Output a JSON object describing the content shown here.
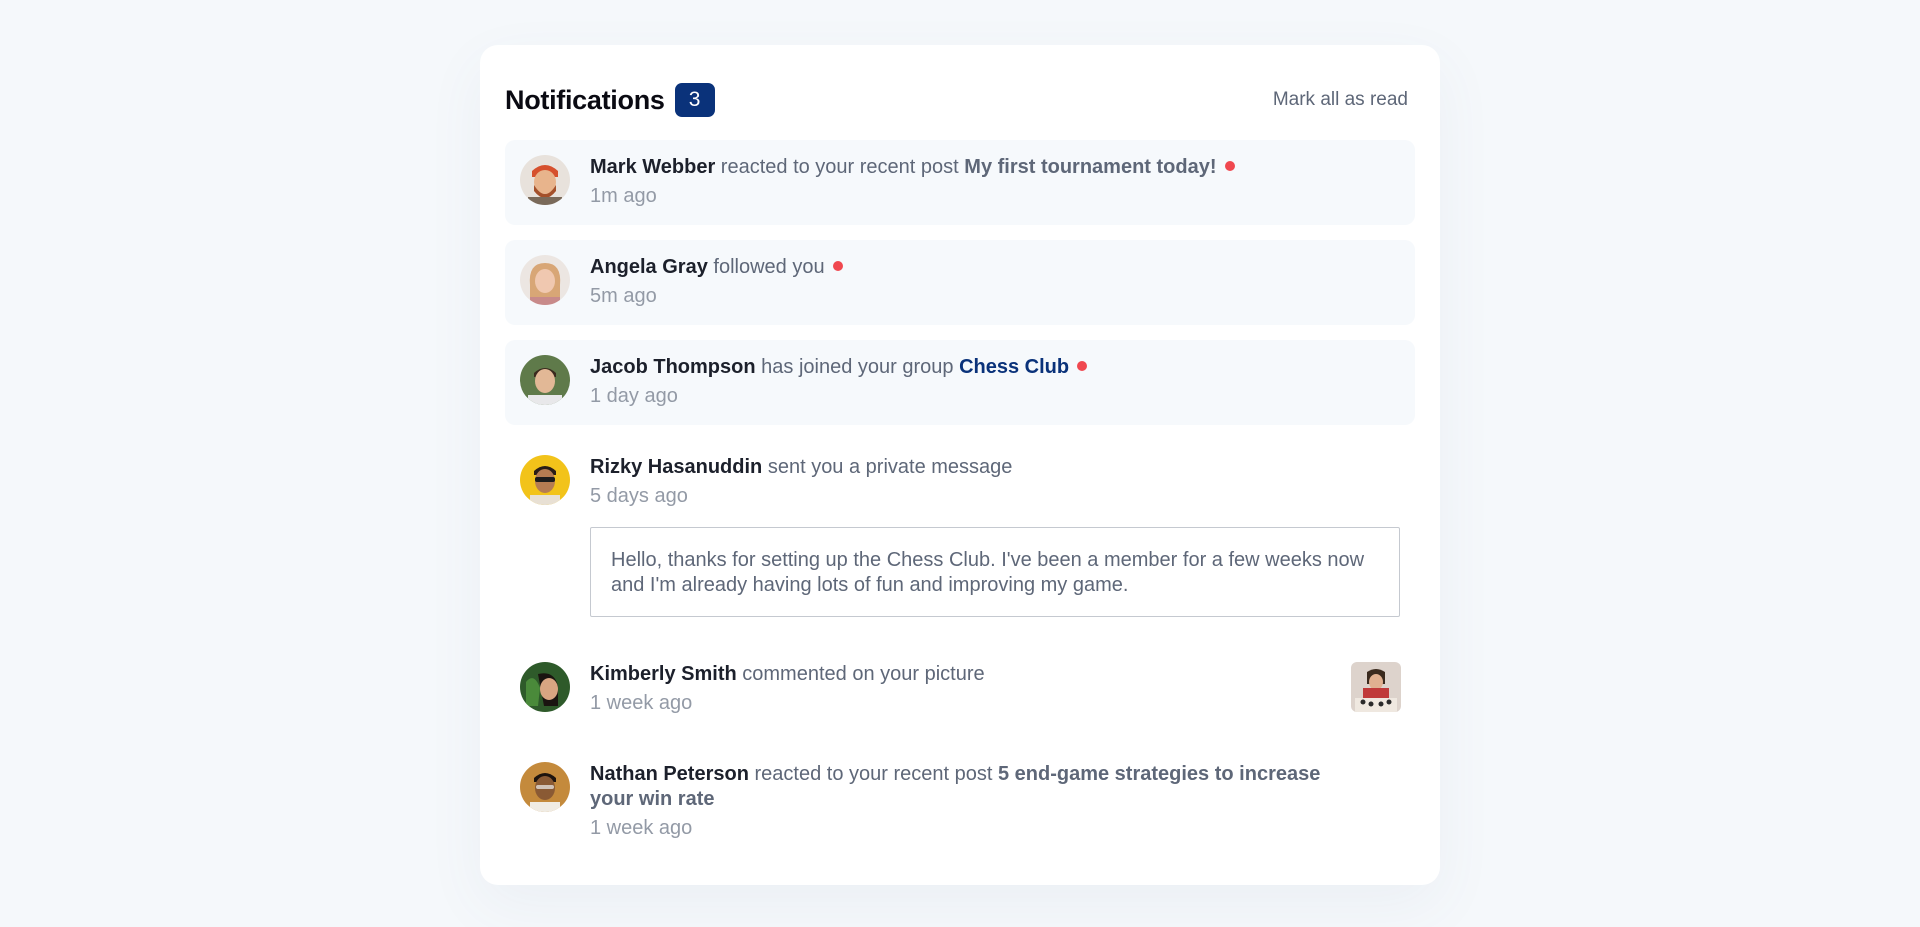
{
  "header": {
    "title": "Notifications",
    "count": "3",
    "mark_all": "Mark all as read"
  },
  "colors": {
    "accent": "#0a327a",
    "unread_dot": "#f0484f",
    "unread_bg": "#f6f9fc"
  },
  "notifications": [
    {
      "name": "Mark Webber",
      "action": "reacted to your recent post",
      "target": "My first tournament today!",
      "time": "1m ago",
      "unread": true,
      "avatar": "avatar-mark-webber"
    },
    {
      "name": "Angela Gray",
      "action": "followed you",
      "time": "5m ago",
      "unread": true,
      "avatar": "avatar-angela-gray"
    },
    {
      "name": "Jacob Thompson",
      "action": "has joined your group",
      "target": "Chess Club",
      "time": "1 day ago",
      "unread": true,
      "avatar": "avatar-jacob-thompson"
    },
    {
      "name": "Rizky Hasanuddin",
      "action": "sent you a private message",
      "time": "5 days ago",
      "unread": false,
      "message": "Hello, thanks for setting up the Chess Club. I've been a member for a few weeks now and I'm already having lots of fun and improving my game.",
      "avatar": "avatar-rizky-hasanuddin"
    },
    {
      "name": "Kimberly Smith",
      "action": "commented on your picture",
      "time": "1 week ago",
      "unread": false,
      "avatar": "avatar-kimberly-smith",
      "picture": "chess-picture-thumbnail"
    },
    {
      "name": "Nathan Peterson",
      "action": "reacted to your recent post",
      "target": "5 end-game strategies to increase your win rate",
      "time": "1 week ago",
      "unread": false,
      "avatar": "avatar-nathan-peterson"
    }
  ]
}
